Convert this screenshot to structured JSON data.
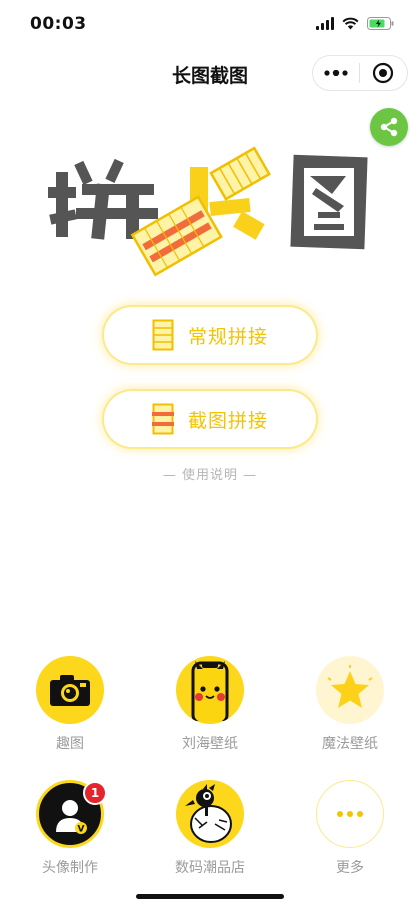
{
  "status": {
    "time": "00:03"
  },
  "nav": {
    "title": "长图截图"
  },
  "buttons": {
    "regular": "常规拼接",
    "screenshot": "截图拼接"
  },
  "instructions": "— 使用说明 —",
  "grid": [
    {
      "label": "趣图",
      "icon": "camera-icon"
    },
    {
      "label": "刘海壁纸",
      "icon": "pikachu-phone-icon"
    },
    {
      "label": "魔法壁纸",
      "icon": "star-icon"
    },
    {
      "label": "头像制作",
      "icon": "avatar-icon",
      "badge": "1"
    },
    {
      "label": "数码潮品店",
      "icon": "bird-icon"
    },
    {
      "label": "更多",
      "icon": "more-icon"
    }
  ],
  "colors": {
    "accent_yellow": "#f5c400",
    "share_green": "#6cc644",
    "logo_gray": "#555555",
    "badge_red": "#e3262e"
  }
}
